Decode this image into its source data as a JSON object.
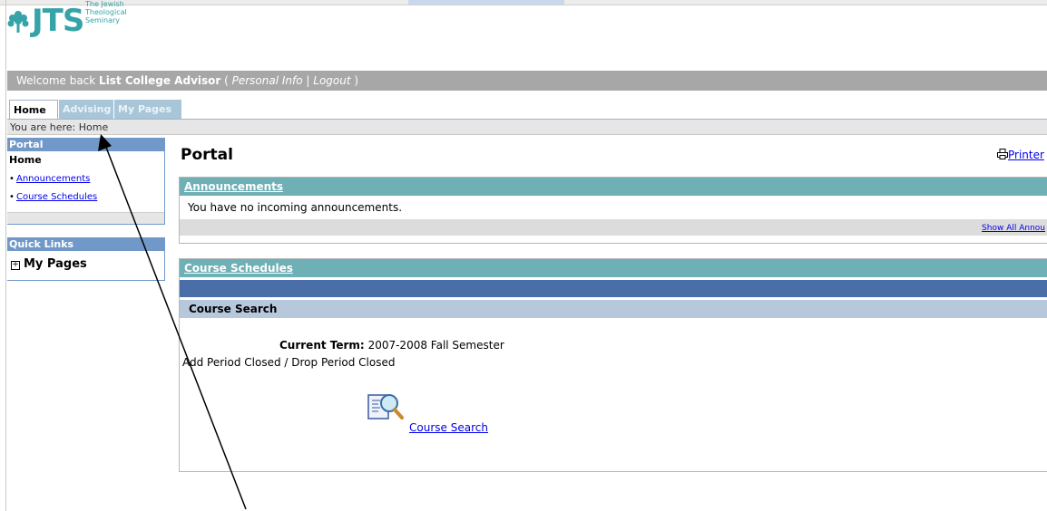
{
  "logo": {
    "text": "JTS",
    "subtitle_lines": [
      "The Jewish",
      "Theological",
      "Seminary"
    ]
  },
  "welcome": {
    "prefix": "Welcome back ",
    "user": "List College Advisor",
    "open": " ( ",
    "personal_info": "Personal Info",
    "sep": " | ",
    "logout": "Logout",
    "close": " )"
  },
  "tabs": [
    {
      "label": "Home",
      "active": true
    },
    {
      "label": "Advising",
      "active": false
    },
    {
      "label": "My Pages",
      "active": false
    }
  ],
  "breadcrumb": {
    "label": "You are here:",
    "current": "Home"
  },
  "sidebar": {
    "portal_header": "Portal",
    "home": "Home",
    "links": [
      "Announcements",
      "Course Schedules"
    ],
    "quick_links_header": "Quick Links",
    "my_pages": "My Pages"
  },
  "main": {
    "title": "Portal",
    "printer_label": "Printer",
    "announcements": {
      "header": "Announcements",
      "message": "You have no incoming announcements.",
      "show_all": "Show All Annou"
    },
    "course_schedules": {
      "header": "Course Schedules",
      "search_header": "Course Search",
      "term_label": "Current Term:",
      "term_value": "2007-2008 Fall Semester",
      "period_status": "Add Period Closed / Drop Period Closed",
      "search_link": "Course Search"
    }
  },
  "colors": {
    "teal": "#6fafb6",
    "blue_header": "#7099c9",
    "dark_blue": "#4a6fa8",
    "welcome_bar": "#a7a7a7"
  },
  "icons": [
    "tree-logo-icon",
    "printer-icon",
    "magnifier-document-icon",
    "expand-plus-icon"
  ]
}
